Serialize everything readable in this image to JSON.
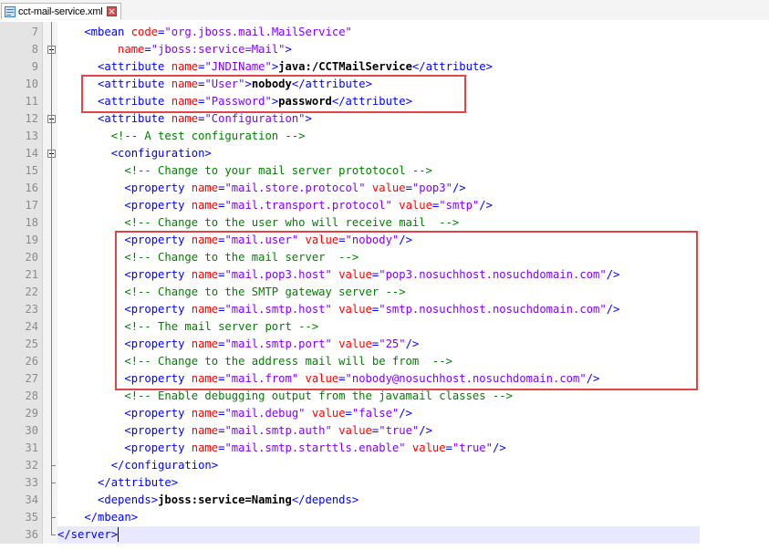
{
  "tab": {
    "label": "cct-mail-service.xml",
    "file_icon": "xml-file-icon",
    "close_icon": "close-icon"
  },
  "colors": {
    "tag": "#0000ff",
    "attr": "#ff0000",
    "value": "#8000ff",
    "comment": "#008000",
    "highlight_box": "#e0454a"
  },
  "lines": [
    {
      "n": "7",
      "segs": [
        [
          "t",
          "    <mbean "
        ],
        [
          "a",
          "code"
        ],
        [
          "t",
          "="
        ],
        [
          "v",
          "\"org.jboss.mail.MailService\""
        ]
      ]
    },
    {
      "n": "8",
      "segs": [
        [
          "t",
          "         "
        ],
        [
          "a",
          "name"
        ],
        [
          "t",
          "="
        ],
        [
          "v",
          "\"jboss:service=Mail\""
        ],
        [
          "t",
          ">"
        ]
      ]
    },
    {
      "n": "9",
      "segs": [
        [
          "t",
          "      <attribute "
        ],
        [
          "a",
          "name"
        ],
        [
          "t",
          "="
        ],
        [
          "v",
          "\"JNDIName\""
        ],
        [
          "t",
          ">"
        ],
        [
          "x",
          "java:/CCTMailService"
        ],
        [
          "t",
          "</attribute>"
        ]
      ]
    },
    {
      "n": "10",
      "segs": [
        [
          "t",
          "      <attribute "
        ],
        [
          "a",
          "name"
        ],
        [
          "t",
          "="
        ],
        [
          "v",
          "\"User\""
        ],
        [
          "t",
          ">"
        ],
        [
          "x",
          "nobody"
        ],
        [
          "t",
          "</attribute>"
        ]
      ]
    },
    {
      "n": "11",
      "segs": [
        [
          "t",
          "      <attribute "
        ],
        [
          "a",
          "name"
        ],
        [
          "t",
          "="
        ],
        [
          "v",
          "\"Password\""
        ],
        [
          "t",
          ">"
        ],
        [
          "x",
          "password"
        ],
        [
          "t",
          "</attribute>"
        ]
      ]
    },
    {
      "n": "12",
      "segs": [
        [
          "t",
          "      <attribute "
        ],
        [
          "a",
          "name"
        ],
        [
          "t",
          "="
        ],
        [
          "v",
          "\"Configuration\""
        ],
        [
          "t",
          ">"
        ]
      ]
    },
    {
      "n": "13",
      "segs": [
        [
          "c",
          "        <!-- A test configuration -->"
        ]
      ]
    },
    {
      "n": "14",
      "segs": [
        [
          "t",
          "        <configuration>"
        ]
      ]
    },
    {
      "n": "15",
      "segs": [
        [
          "c",
          "          <!-- Change to your mail server prototocol -->"
        ]
      ]
    },
    {
      "n": "16",
      "segs": [
        [
          "t",
          "          <property "
        ],
        [
          "a",
          "name"
        ],
        [
          "t",
          "="
        ],
        [
          "v",
          "\"mail.store.protocol\""
        ],
        [
          "t",
          " "
        ],
        [
          "a",
          "value"
        ],
        [
          "t",
          "="
        ],
        [
          "v",
          "\"pop3\""
        ],
        [
          "t",
          "/>"
        ]
      ]
    },
    {
      "n": "17",
      "segs": [
        [
          "t",
          "          <property "
        ],
        [
          "a",
          "name"
        ],
        [
          "t",
          "="
        ],
        [
          "v",
          "\"mail.transport.protocol\""
        ],
        [
          "t",
          " "
        ],
        [
          "a",
          "value"
        ],
        [
          "t",
          "="
        ],
        [
          "v",
          "\"smtp\""
        ],
        [
          "t",
          "/>"
        ]
      ]
    },
    {
      "n": "18",
      "segs": [
        [
          "c",
          "          <!-- Change to the user who will receive mail  -->"
        ]
      ]
    },
    {
      "n": "19",
      "segs": [
        [
          "t",
          "          <property "
        ],
        [
          "a",
          "name"
        ],
        [
          "t",
          "="
        ],
        [
          "v",
          "\"mail.user\""
        ],
        [
          "t",
          " "
        ],
        [
          "a",
          "value"
        ],
        [
          "t",
          "="
        ],
        [
          "v",
          "\"nobody\""
        ],
        [
          "t",
          "/>"
        ]
      ]
    },
    {
      "n": "20",
      "segs": [
        [
          "c",
          "          <!-- Change to the mail server  -->"
        ]
      ]
    },
    {
      "n": "21",
      "segs": [
        [
          "t",
          "          <property "
        ],
        [
          "a",
          "name"
        ],
        [
          "t",
          "="
        ],
        [
          "v",
          "\"mail.pop3.host\""
        ],
        [
          "t",
          " "
        ],
        [
          "a",
          "value"
        ],
        [
          "t",
          "="
        ],
        [
          "v",
          "\"pop3.nosuchhost.nosuchdomain.com\""
        ],
        [
          "t",
          "/>"
        ]
      ]
    },
    {
      "n": "22",
      "segs": [
        [
          "c",
          "          <!-- Change to the SMTP gateway server -->"
        ]
      ]
    },
    {
      "n": "23",
      "segs": [
        [
          "t",
          "          <property "
        ],
        [
          "a",
          "name"
        ],
        [
          "t",
          "="
        ],
        [
          "v",
          "\"mail.smtp.host\""
        ],
        [
          "t",
          " "
        ],
        [
          "a",
          "value"
        ],
        [
          "t",
          "="
        ],
        [
          "v",
          "\"smtp.nosuchhost.nosuchdomain.com\""
        ],
        [
          "t",
          "/>"
        ]
      ]
    },
    {
      "n": "24",
      "segs": [
        [
          "c",
          "          <!-- The mail server port -->"
        ]
      ]
    },
    {
      "n": "25",
      "segs": [
        [
          "t",
          "          <property "
        ],
        [
          "a",
          "name"
        ],
        [
          "t",
          "="
        ],
        [
          "v",
          "\"mail.smtp.port\""
        ],
        [
          "t",
          " "
        ],
        [
          "a",
          "value"
        ],
        [
          "t",
          "="
        ],
        [
          "v",
          "\"25\""
        ],
        [
          "t",
          "/>"
        ]
      ]
    },
    {
      "n": "26",
      "segs": [
        [
          "c",
          "          <!-- Change to the address mail will be from  -->"
        ]
      ]
    },
    {
      "n": "27",
      "segs": [
        [
          "t",
          "          <property "
        ],
        [
          "a",
          "name"
        ],
        [
          "t",
          "="
        ],
        [
          "v",
          "\"mail.from\""
        ],
        [
          "t",
          " "
        ],
        [
          "a",
          "value"
        ],
        [
          "t",
          "="
        ],
        [
          "v",
          "\"nobody@nosuchhost.nosuchdomain.com\""
        ],
        [
          "t",
          "/>"
        ]
      ]
    },
    {
      "n": "28",
      "segs": [
        [
          "c",
          "          <!-- Enable debugging output from the javamail classes -->"
        ]
      ]
    },
    {
      "n": "29",
      "segs": [
        [
          "t",
          "          <property "
        ],
        [
          "a",
          "name"
        ],
        [
          "t",
          "="
        ],
        [
          "v",
          "\"mail.debug\""
        ],
        [
          "t",
          " "
        ],
        [
          "a",
          "value"
        ],
        [
          "t",
          "="
        ],
        [
          "v",
          "\"false\""
        ],
        [
          "t",
          "/>"
        ]
      ]
    },
    {
      "n": "30",
      "segs": [
        [
          "t",
          "          <property "
        ],
        [
          "a",
          "name"
        ],
        [
          "t",
          "="
        ],
        [
          "v",
          "\"mail.smtp.auth\""
        ],
        [
          "t",
          " "
        ],
        [
          "a",
          "value"
        ],
        [
          "t",
          "="
        ],
        [
          "v",
          "\"true\""
        ],
        [
          "t",
          "/>"
        ]
      ]
    },
    {
      "n": "31",
      "segs": [
        [
          "t",
          "          <property "
        ],
        [
          "a",
          "name"
        ],
        [
          "t",
          "="
        ],
        [
          "v",
          "\"mail.smtp.starttls.enable\""
        ],
        [
          "t",
          " "
        ],
        [
          "a",
          "value"
        ],
        [
          "t",
          "="
        ],
        [
          "v",
          "\"true\""
        ],
        [
          "t",
          "/>"
        ]
      ]
    },
    {
      "n": "32",
      "segs": [
        [
          "t",
          "        </configuration>"
        ]
      ]
    },
    {
      "n": "33",
      "segs": [
        [
          "t",
          "      </attribute>"
        ]
      ]
    },
    {
      "n": "34",
      "segs": [
        [
          "t",
          "      <depends>"
        ],
        [
          "x",
          "jboss:service=Naming"
        ],
        [
          "t",
          "</depends>"
        ]
      ]
    },
    {
      "n": "35",
      "segs": [
        [
          "t",
          "    </mbean>"
        ]
      ]
    },
    {
      "n": "36",
      "segs": [
        [
          "t",
          "</server>"
        ]
      ]
    }
  ]
}
